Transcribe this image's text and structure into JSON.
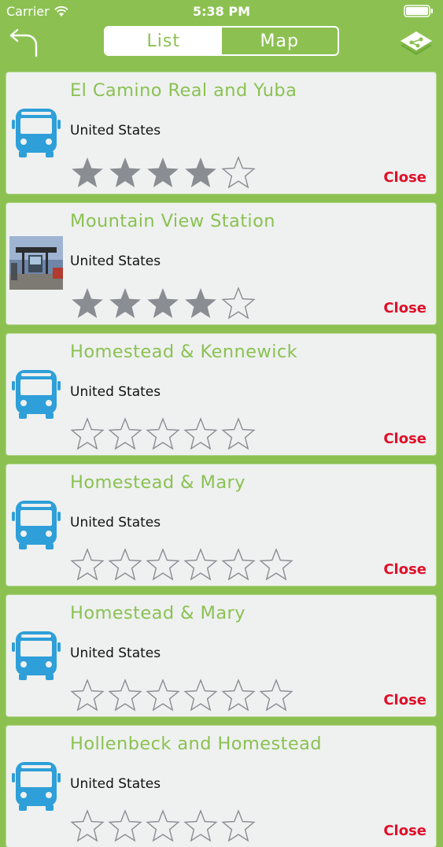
{
  "status": {
    "carrier": "Carrier",
    "time": "5:38 PM"
  },
  "nav": {
    "tabs": [
      {
        "label": "List",
        "selected": true
      },
      {
        "label": "Map",
        "selected": false
      }
    ],
    "accent": "#8cc152"
  },
  "stops": [
    {
      "title": "El Camino Real and Yuba",
      "country": "United States",
      "rating": 4,
      "close_label": "Close",
      "thumb": "bus-icon"
    },
    {
      "title": "Mountain View Station",
      "country": "United States",
      "rating": 4,
      "close_label": "Close",
      "thumb": "station-photo"
    },
    {
      "title": "Homestead & Kennewick",
      "country": "United States",
      "rating": 0,
      "close_label": "Close",
      "thumb": "bus-icon"
    },
    {
      "title": "Homestead & Mary",
      "country": "United States",
      "rating": 0,
      "close_label": "Close",
      "thumb": "bus-icon"
    },
    {
      "title": "Homestead & Mary",
      "country": "United States",
      "rating": 0,
      "close_label": "Close",
      "thumb": "bus-icon"
    },
    {
      "title": "Hollenbeck and Homestead",
      "country": "United States",
      "rating": 0,
      "close_label": "Close",
      "thumb": "bus-icon"
    }
  ],
  "colors": {
    "title": "#8cc152",
    "close": "#e0102a",
    "bus": "#2e9fd8",
    "star_filled": "#8a8d92"
  }
}
